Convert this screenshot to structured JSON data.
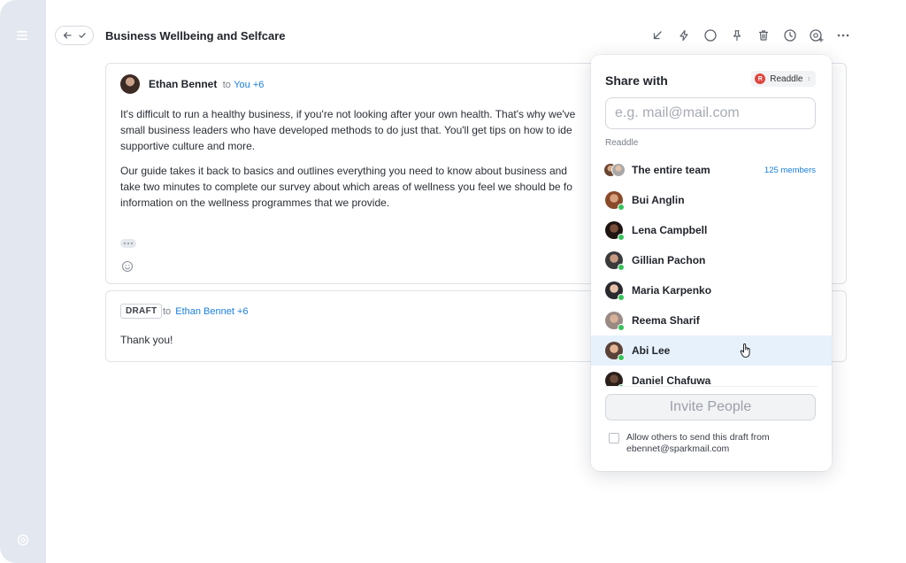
{
  "colors": {
    "accent": "#1a7fe0",
    "online": "#35c35a",
    "sidebar": "#e3e7ef",
    "team_badge": "#e0463e",
    "hover_row": "#e6f1fc"
  },
  "sidebar": {
    "menu_icon": "hamburger-icon",
    "settings_icon": "gear-icon"
  },
  "toolbar": {
    "subject": "Business Wellbeing and Selfcare",
    "icons": [
      "arrow-down-left-icon",
      "lightning-icon",
      "circle-icon",
      "pin-icon",
      "trash-icon",
      "clock-icon",
      "mention-add-icon",
      "more-icon"
    ]
  },
  "message": {
    "sender": "Ethan Bennet",
    "to_prefix": "to",
    "recipients": "You +6",
    "paragraphs": [
      "It's difficult to run a healthy business, if you're not looking after your own health. That's why we've",
      "small business leaders who have developed methods to do just that. You'll get tips on how to ide",
      "supportive culture and more.",
      "Our guide takes it back to basics and outlines everything you need to know about business and",
      "take two minutes to complete our survey about which areas of wellness you feel we should be fo",
      "information on the wellness programmes that we provide."
    ]
  },
  "draft": {
    "badge": "DRAFT",
    "to_prefix": "to",
    "recipients": "Ethan Bennet +6",
    "body": "Thank you!"
  },
  "share": {
    "title": "Share with",
    "team": {
      "initial": "R",
      "name": "Readdle"
    },
    "email_placeholder": "e.g. mail@mail.com",
    "email_value": "",
    "section_label": "Readdle",
    "team_row": {
      "name": "The entire team",
      "count": "125 members"
    },
    "people": [
      {
        "name": "Bui Anglin",
        "online": true
      },
      {
        "name": "Lena Campbell",
        "online": true
      },
      {
        "name": "Gillian Pachon",
        "online": true
      },
      {
        "name": "Maria Karpenko",
        "online": true
      },
      {
        "name": "Reema Sharif",
        "online": true
      },
      {
        "name": "Abi Lee",
        "online": true
      },
      {
        "name": "Daniel Chafuwa",
        "online": true
      }
    ],
    "invite_label": "Invite People",
    "allow_text": "Allow others to send this draft from ebennet@sparkmail.com",
    "allow_checked": false
  }
}
